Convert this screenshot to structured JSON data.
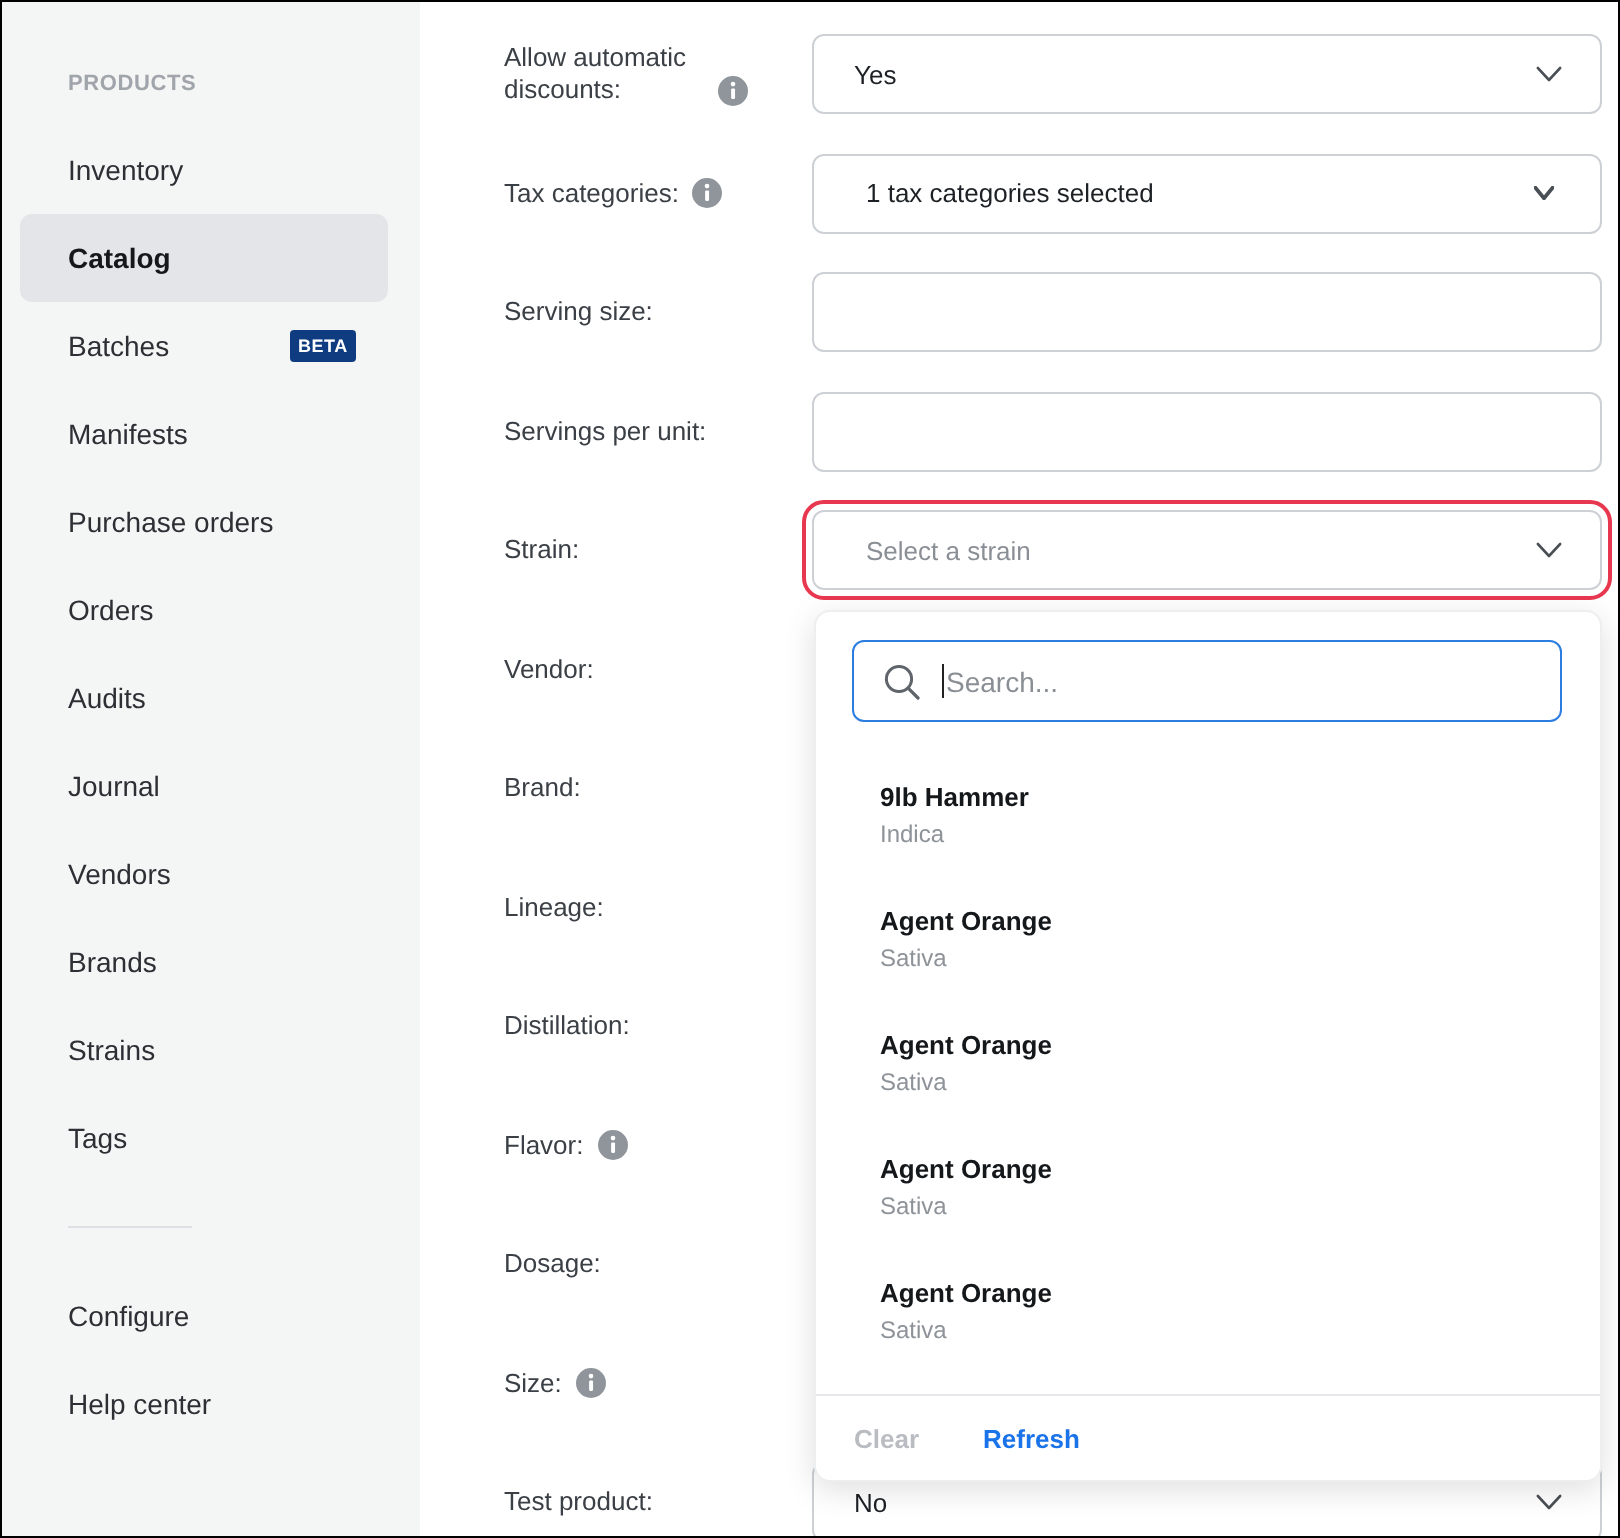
{
  "sidebar": {
    "section_title": "PRODUCTS",
    "items": [
      {
        "label": "Inventory",
        "selected": false
      },
      {
        "label": "Catalog",
        "selected": true
      },
      {
        "label": "Batches",
        "selected": false,
        "badge": "BETA"
      },
      {
        "label": "Manifests",
        "selected": false
      },
      {
        "label": "Purchase orders",
        "selected": false
      },
      {
        "label": "Orders",
        "selected": false
      },
      {
        "label": "Audits",
        "selected": false
      },
      {
        "label": "Journal",
        "selected": false
      },
      {
        "label": "Vendors",
        "selected": false
      },
      {
        "label": "Brands",
        "selected": false
      },
      {
        "label": "Strains",
        "selected": false
      },
      {
        "label": "Tags",
        "selected": false
      }
    ],
    "footer_items": [
      {
        "label": "Configure",
        "selected": false
      },
      {
        "label": "Help center",
        "selected": false
      }
    ]
  },
  "form": {
    "fields": [
      {
        "label": "Allow automatic discounts:",
        "info": true,
        "control": {
          "kind": "select",
          "value": "Yes",
          "highlighted": false
        }
      },
      {
        "label": "Tax categories:",
        "info": true,
        "control": {
          "kind": "multiselect",
          "value": "1 tax categories selected",
          "highlighted": false
        }
      },
      {
        "label": "Serving size:",
        "info": false,
        "control": {
          "kind": "text",
          "highlighted": false
        }
      },
      {
        "label": "Servings per unit:",
        "info": false,
        "control": {
          "kind": "text",
          "highlighted": false
        }
      },
      {
        "label": "Strain:",
        "info": false,
        "control": {
          "kind": "select",
          "placeholder": "Select a strain",
          "highlighted": true,
          "expanded": true,
          "menu": {
            "search": {
              "placeholder": "Search..."
            },
            "options": [
              {
                "name": "9lb Hammer",
                "type": "Indica"
              },
              {
                "name": "Agent Orange",
                "type": "Sativa"
              },
              {
                "name": "Agent Orange",
                "type": "Sativa"
              },
              {
                "name": "Agent Orange",
                "type": "Sativa"
              },
              {
                "name": "Agent Orange",
                "type": "Sativa"
              }
            ],
            "buttons": [
              {
                "label": "Clear",
                "disabled": true
              },
              {
                "label": "Refresh",
                "disabled": false
              }
            ]
          }
        }
      },
      {
        "label": "Vendor:",
        "info": false
      },
      {
        "label": "Brand:",
        "info": false
      },
      {
        "label": "Lineage:",
        "info": false
      },
      {
        "label": "Distillation:",
        "info": false
      },
      {
        "label": "Flavor:",
        "info": true
      },
      {
        "label": "Dosage:",
        "info": false
      },
      {
        "label": "Size:",
        "info": true
      },
      {
        "label": "Test product:",
        "info": false,
        "control": {
          "kind": "select",
          "value": "No"
        }
      }
    ]
  }
}
